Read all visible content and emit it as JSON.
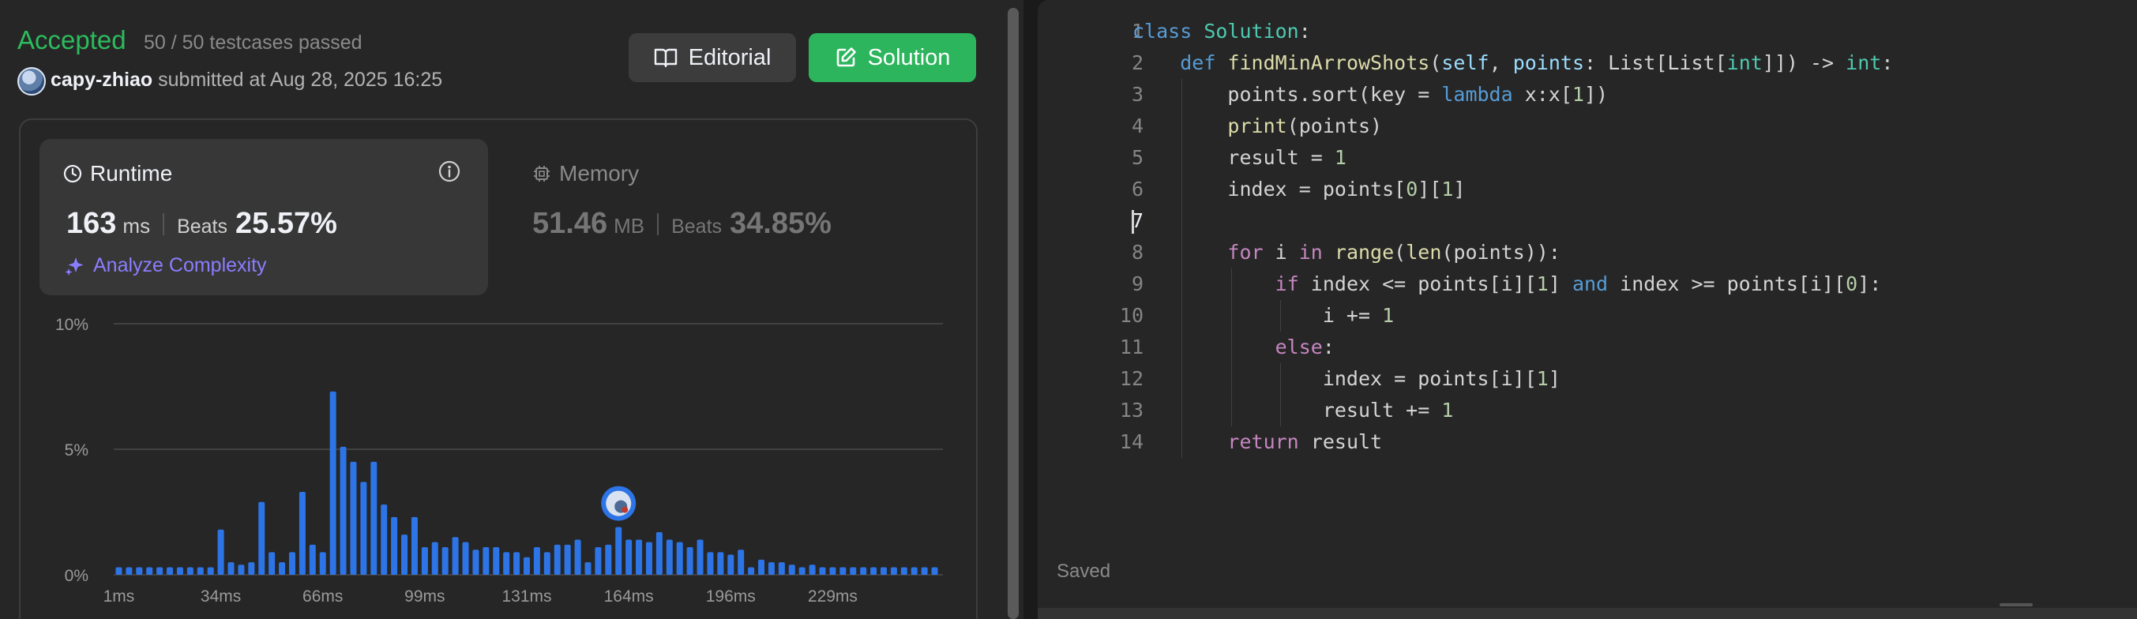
{
  "submission": {
    "status": "Accepted",
    "testcases": "50 / 50 testcases passed",
    "username": "capy-zhiao",
    "submitted_text": "submitted at Aug 28, 2025 16:25"
  },
  "buttons": {
    "editorial": "Editorial",
    "solution": "Solution"
  },
  "runtime": {
    "label": "Runtime",
    "value": "163",
    "unit": "ms",
    "beats_label": "Beats",
    "beats": "25.57%",
    "analyze": "Analyze Complexity"
  },
  "memory": {
    "label": "Memory",
    "value": "51.46",
    "unit": "MB",
    "beats_label": "Beats",
    "beats": "34.85%"
  },
  "chart_data": {
    "type": "bar",
    "ylim": [
      0,
      10
    ],
    "y_tick_labels": [
      "10%",
      "5%",
      "0%"
    ],
    "y_ticks": [
      10,
      5,
      0
    ],
    "x_tick_labels": [
      "1ms",
      "34ms",
      "66ms",
      "99ms",
      "131ms",
      "164ms",
      "196ms",
      "229ms"
    ],
    "x_tick_bar_index": [
      0,
      10,
      20,
      30,
      40,
      50,
      60,
      70
    ],
    "values": [
      0.3,
      0.3,
      0.3,
      0.3,
      0.3,
      0.3,
      0.3,
      0.3,
      0.3,
      0.3,
      1.8,
      0.5,
      0.4,
      0.5,
      2.9,
      0.9,
      0.5,
      0.9,
      3.3,
      1.2,
      0.9,
      7.3,
      5.1,
      4.5,
      3.7,
      4.5,
      2.8,
      2.3,
      1.6,
      2.3,
      1.1,
      1.3,
      1.1,
      1.5,
      1.3,
      1.0,
      1.1,
      1.1,
      0.9,
      0.9,
      0.7,
      1.1,
      0.9,
      1.2,
      1.2,
      1.4,
      0.5,
      1.1,
      1.2,
      1.9,
      1.4,
      1.4,
      1.3,
      1.7,
      1.4,
      1.3,
      1.1,
      1.4,
      0.9,
      0.9,
      0.8,
      1.0,
      0.3,
      0.6,
      0.5,
      0.5,
      0.4,
      0.3,
      0.4,
      0.3,
      0.3,
      0.3,
      0.3,
      0.3,
      0.3,
      0.3,
      0.3,
      0.3,
      0.3,
      0.3,
      0.3
    ],
    "highlight_bar_index": 49,
    "bar_color": "#2d74e6"
  },
  "code": {
    "lines": [
      [
        [
          "kw2",
          "class"
        ],
        [
          "plain",
          " "
        ],
        [
          "cls",
          "Solution"
        ],
        [
          "plain",
          ":"
        ]
      ],
      [
        [
          "plain",
          "    "
        ],
        [
          "kw2",
          "def"
        ],
        [
          "plain",
          " "
        ],
        [
          "fn",
          "findMinArrowShots"
        ],
        [
          "plain",
          "("
        ],
        [
          "prm",
          "self"
        ],
        [
          "plain",
          ", "
        ],
        [
          "prm",
          "points"
        ],
        [
          "plain",
          ": List[List["
        ],
        [
          "typ",
          "int"
        ],
        [
          "plain",
          "]]) -> "
        ],
        [
          "typ",
          "int"
        ],
        [
          "plain",
          ":"
        ]
      ],
      [
        [
          "plain",
          "        points.sort(key = "
        ],
        [
          "kw2",
          "lambda"
        ],
        [
          "plain",
          " x:x["
        ],
        [
          "num",
          "1"
        ],
        [
          "plain",
          "])"
        ]
      ],
      [
        [
          "plain",
          "        "
        ],
        [
          "fn",
          "print"
        ],
        [
          "plain",
          "(points)"
        ]
      ],
      [
        [
          "plain",
          "        result = "
        ],
        [
          "num",
          "1"
        ]
      ],
      [
        [
          "plain",
          "        index = points["
        ],
        [
          "num",
          "0"
        ],
        [
          "plain",
          "]["
        ],
        [
          "num",
          "1"
        ],
        [
          "plain",
          "]"
        ]
      ],
      [
        [
          "plain",
          ""
        ]
      ],
      [
        [
          "plain",
          "        "
        ],
        [
          "kw",
          "for"
        ],
        [
          "plain",
          " i "
        ],
        [
          "kw",
          "in"
        ],
        [
          "plain",
          " "
        ],
        [
          "fn",
          "range"
        ],
        [
          "plain",
          "("
        ],
        [
          "fn",
          "len"
        ],
        [
          "plain",
          "(points)):"
        ]
      ],
      [
        [
          "plain",
          "            "
        ],
        [
          "kw",
          "if"
        ],
        [
          "plain",
          " index <= points[i]["
        ],
        [
          "num",
          "1"
        ],
        [
          "plain",
          "] "
        ],
        [
          "kw2",
          "and"
        ],
        [
          "plain",
          " index >= points[i]["
        ],
        [
          "num",
          "0"
        ],
        [
          "plain",
          "]:"
        ]
      ],
      [
        [
          "plain",
          "                i += "
        ],
        [
          "num",
          "1"
        ]
      ],
      [
        [
          "plain",
          "            "
        ],
        [
          "kw",
          "else"
        ],
        [
          "plain",
          ":"
        ]
      ],
      [
        [
          "plain",
          "                index = points[i]["
        ],
        [
          "num",
          "1"
        ],
        [
          "plain",
          "]"
        ]
      ],
      [
        [
          "plain",
          "                result += "
        ],
        [
          "num",
          "1"
        ]
      ],
      [
        [
          "plain",
          "        "
        ],
        [
          "kw",
          "return"
        ],
        [
          "plain",
          " result"
        ]
      ]
    ],
    "indents": [
      0,
      1,
      2,
      2,
      2,
      2,
      2,
      2,
      3,
      4,
      3,
      4,
      4,
      2
    ],
    "active_line": 7
  },
  "editor": {
    "saved": "Saved"
  },
  "colors": {
    "accepted": "#2cbb5d",
    "solution_button": "#2db55d",
    "analyze": "#8b7dff",
    "bar": "#2d74e6"
  }
}
